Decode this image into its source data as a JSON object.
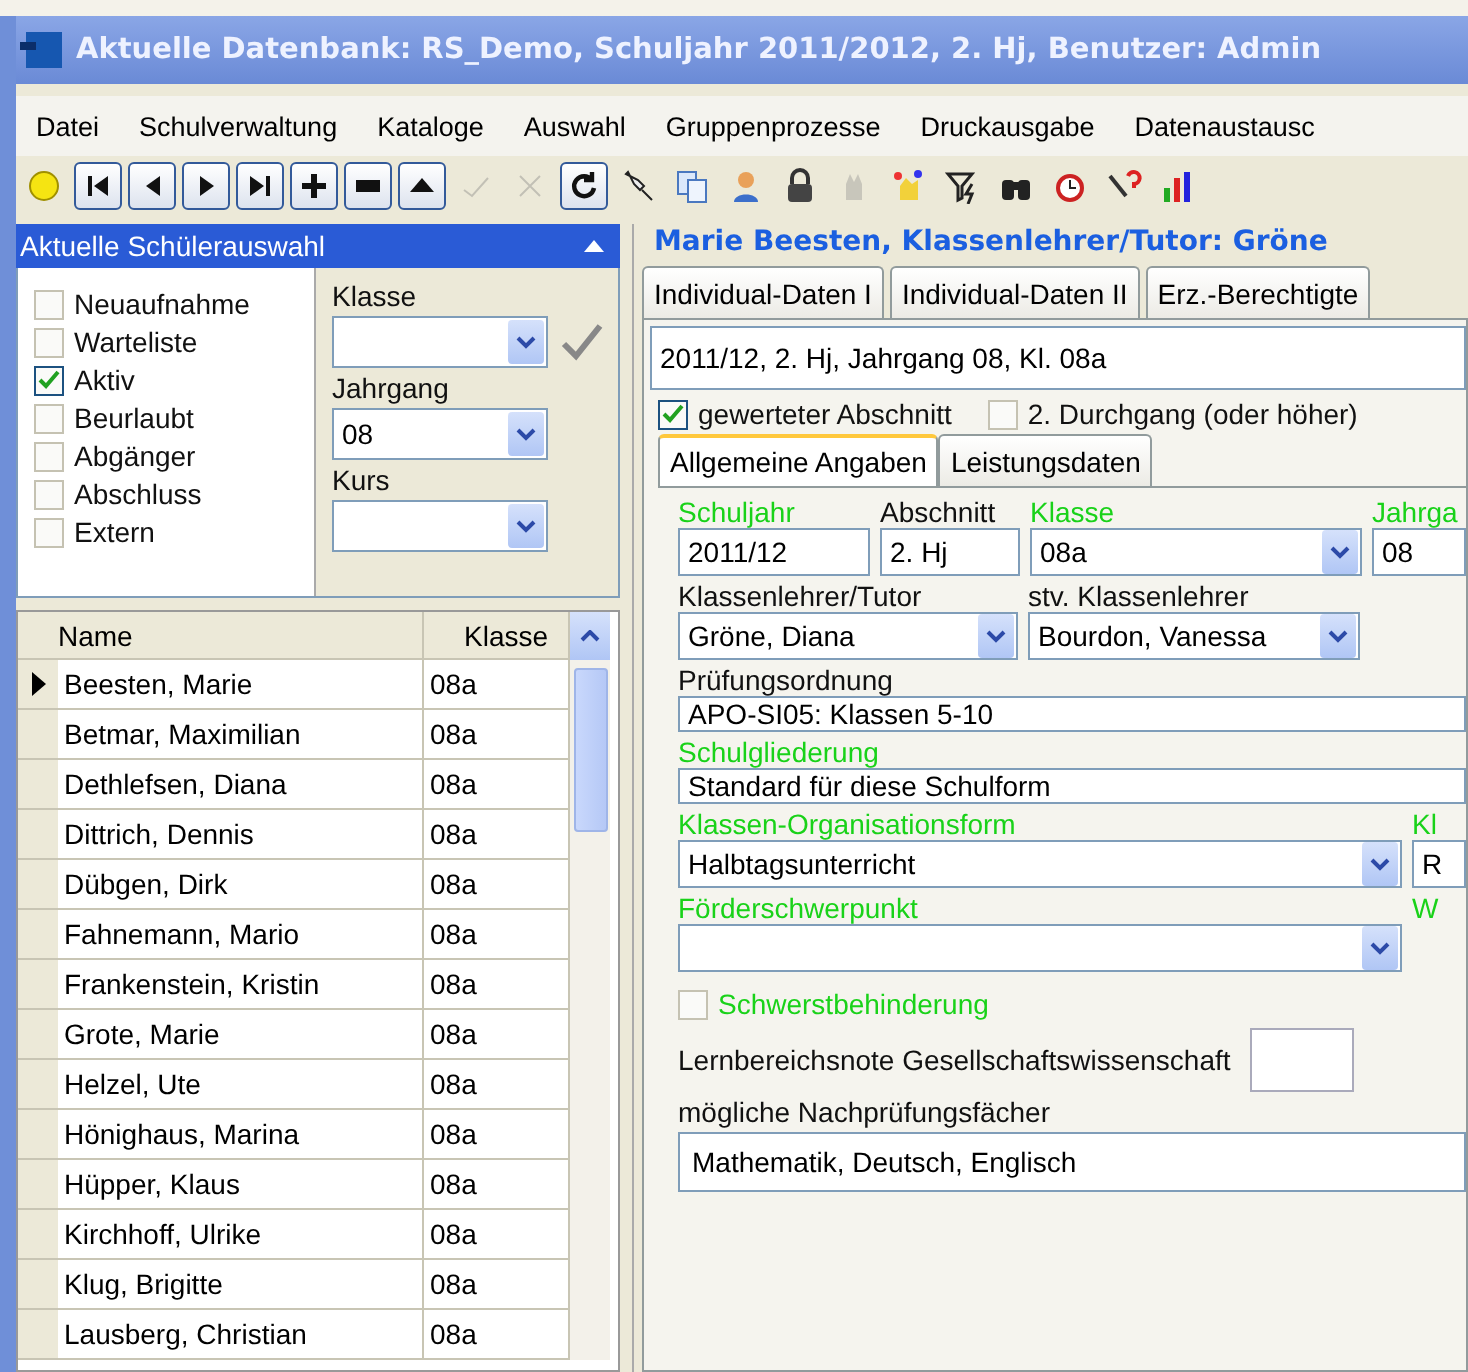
{
  "window": {
    "title": "Aktuelle Datenbank: RS_Demo, Schuljahr 2011/2012, 2. Hj, Benutzer: Admin"
  },
  "menu": [
    "Datei",
    "Schulverwaltung",
    "Kataloge",
    "Auswahl",
    "Gruppenprozesse",
    "Druckausgabe",
    "Datenaustausc"
  ],
  "toolbar": [
    {
      "disabled": false
    },
    {
      "disabled": false
    },
    {
      "disabled": false
    },
    {
      "disabled": false
    },
    {
      "disabled": false
    },
    {
      "disabled": false
    },
    {
      "disabled": false
    },
    {
      "disabled": false
    },
    {
      "disabled": true
    },
    {
      "disabled": true
    },
    {
      "disabled": false
    },
    {
      "disabled": false
    },
    {
      "disabled": false
    },
    {
      "disabled": false
    },
    {
      "disabled": false
    },
    {
      "disabled": true
    },
    {
      "disabled": false
    },
    {
      "disabled": false
    },
    {
      "disabled": false
    },
    {
      "disabled": false
    },
    {
      "disabled": false
    },
    {
      "disabled": false
    }
  ],
  "selection_panel": {
    "title": "Aktuelle Schülerauswahl",
    "filters": [
      {
        "label": "Neuaufnahme",
        "checked": false
      },
      {
        "label": "Warteliste",
        "checked": false
      },
      {
        "label": "Aktiv",
        "checked": true
      },
      {
        "label": "Beurlaubt",
        "checked": false
      },
      {
        "label": "Abgänger",
        "checked": false
      },
      {
        "label": "Abschluss",
        "checked": false
      },
      {
        "label": "Extern",
        "checked": false
      }
    ],
    "fields": [
      {
        "label": "Klasse"
      },
      {
        "label": "Jahrgang",
        "value": "08"
      },
      {
        "label": "Kurs"
      }
    ]
  },
  "student_table": {
    "columns": [
      "Name",
      "Klasse"
    ],
    "rows": [
      {
        "name": "Beesten, Marie",
        "klasse": "08a",
        "selected": true
      },
      {
        "name": "Betmar, Maximilian",
        "klasse": "08a",
        "selected": false
      },
      {
        "name": "Dethlefsen, Diana",
        "klasse": "08a",
        "selected": false
      },
      {
        "name": "Dittrich, Dennis",
        "klasse": "08a",
        "selected": false
      },
      {
        "name": "Dübgen, Dirk",
        "klasse": "08a",
        "selected": false
      },
      {
        "name": "Fahnemann, Mario",
        "klasse": "08a",
        "selected": false
      },
      {
        "name": "Frankenstein, Kristin",
        "klasse": "08a",
        "selected": false
      },
      {
        "name": "Grote, Marie",
        "klasse": "08a",
        "selected": false
      },
      {
        "name": "Helzel, Ute",
        "klasse": "08a",
        "selected": false
      },
      {
        "name": "Hönighaus, Marina",
        "klasse": "08a",
        "selected": false
      },
      {
        "name": "Hüpper, Klaus",
        "klasse": "08a",
        "selected": false
      },
      {
        "name": "Kirchhoff, Ulrike",
        "klasse": "08a",
        "selected": false
      },
      {
        "name": "Klug, Brigitte",
        "klasse": "08a",
        "selected": false
      },
      {
        "name": "Lausberg, Christian",
        "klasse": "08a",
        "selected": false
      }
    ]
  },
  "detail": {
    "heading": "Marie Beesten, Klassenlehrer/Tutor: Gröne",
    "tabs": [
      {
        "label": "Individual-Daten I",
        "selected": false
      },
      {
        "label": "Individual-Daten II",
        "selected": false
      },
      {
        "label": "Erz.-Berechtigte",
        "selected": false
      }
    ],
    "summary": "2011/12, 2. Hj, Jahrgang 08, Kl. 08a",
    "checks": [
      {
        "label": "gewerteter Abschnitt",
        "checked": true
      },
      {
        "label": "2. Durchgang (oder höher)",
        "checked": false
      }
    ],
    "subtabs": [
      {
        "label": "Allgemeine Angaben",
        "selected": true
      },
      {
        "label": "Leistungsdaten",
        "selected": false
      }
    ],
    "rows": [
      {
        "fields": [
          {
            "kind": "text",
            "label": "Schuljahr",
            "value": "2011/12",
            "required": true
          },
          {
            "kind": "text",
            "label": "Abschnitt",
            "value": "2. Hj",
            "required": false
          },
          {
            "kind": "combo",
            "label": "Klasse",
            "value": "08a",
            "required": true
          },
          {
            "kind": "text",
            "label": "Jahrga",
            "value": "08",
            "required": true
          }
        ]
      },
      {
        "fields": [
          {
            "kind": "combo",
            "label": "Klassenlehrer/Tutor",
            "value": "Gröne, Diana",
            "required": false
          },
          {
            "kind": "combo",
            "label": "stv. Klassenlehrer",
            "value": "Bourdon, Vanessa",
            "required": false
          }
        ]
      },
      {
        "fields": [
          {
            "kind": "text",
            "label": "Prüfungsordnung",
            "value": "APO-SI05: Klassen 5-10",
            "required": false
          }
        ]
      },
      {
        "fields": [
          {
            "kind": "text",
            "label": "Schulgliederung",
            "value": "Standard für diese Schulform",
            "required": true
          }
        ]
      },
      {
        "fields": [
          {
            "kind": "combo",
            "label": "Klassen-Organisationsform",
            "value": "Halbtagsunterricht",
            "required": true
          },
          {
            "kind": "text",
            "label": "Kl",
            "value": "R",
            "required": true
          }
        ]
      },
      {
        "fields": [
          {
            "kind": "combo",
            "label": "Förderschwerpunkt",
            "required": true
          },
          {
            "kind": "label",
            "label": "W",
            "required": true
          }
        ]
      }
    ],
    "severe": {
      "label": "Schwerstbehinderung",
      "checked": false,
      "required": true
    },
    "grade": {
      "label": "Lernbereichsnote Gesellschaftswissenschaft"
    },
    "retake": {
      "label": "mögliche Nachprüfungsfächer",
      "value": "Mathematik, Deutsch, Englisch"
    }
  }
}
